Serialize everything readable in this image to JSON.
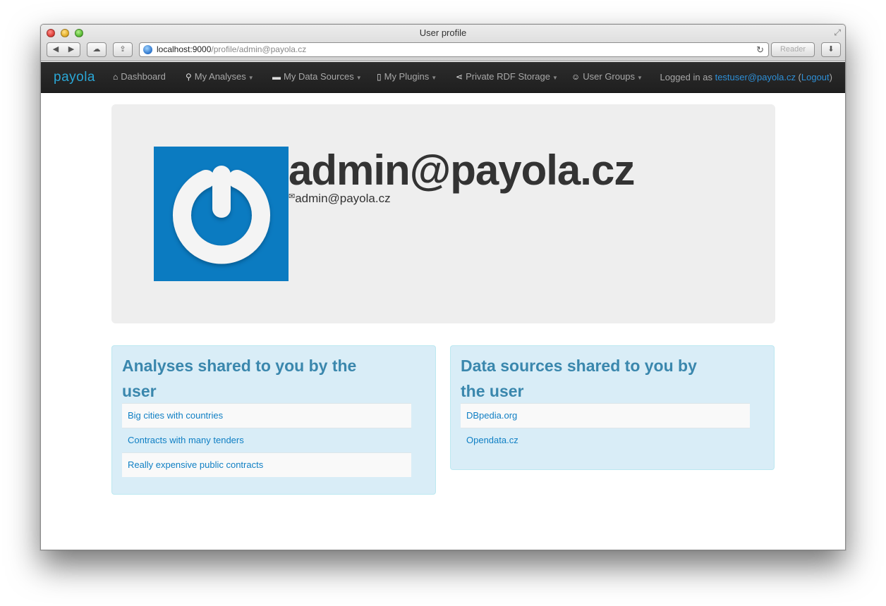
{
  "window": {
    "title": "User profile",
    "reader_label": "Reader"
  },
  "address": {
    "host": "localhost:9000",
    "path": "/profile/admin@payola.cz"
  },
  "navbar": {
    "brand": "payola",
    "items": [
      {
        "label": "Dashboard",
        "icon": "home-icon",
        "dropdown": false
      },
      {
        "label": "My Analyses",
        "icon": "search-icon",
        "dropdown": true
      },
      {
        "label": "My Data Sources",
        "icon": "hdd-icon",
        "dropdown": true
      },
      {
        "label": "My Plugins",
        "icon": "file-icon",
        "dropdown": true
      },
      {
        "label": "Private RDF Storage",
        "icon": "share-icon",
        "dropdown": true
      },
      {
        "label": "User Groups",
        "icon": "group-icon",
        "dropdown": true
      }
    ],
    "logged_prefix": "Logged in as ",
    "logged_user": "testuser@payola.cz",
    "logout": "Logout"
  },
  "profile": {
    "name": "admin@payola.cz",
    "email": "admin@payola.cz",
    "avatar_color": "#0b7bc1"
  },
  "analyses": {
    "heading": "Analyses shared to you by the user",
    "items": [
      "Big cities with countries",
      "Contracts with many tenders",
      "Really expensive public contracts"
    ]
  },
  "data_sources": {
    "heading": "Data sources shared to you by the user",
    "items": [
      "DBpedia.org",
      "Opendata.cz"
    ]
  },
  "colors": {
    "link": "#0f7fc4",
    "heading": "#3a87ad",
    "well_bg": "#d9edf7"
  }
}
